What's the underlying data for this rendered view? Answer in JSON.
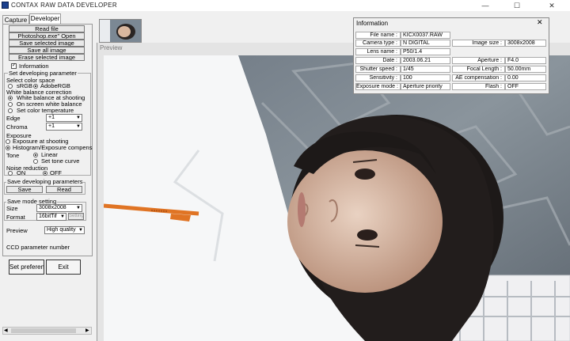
{
  "window": {
    "title": "CONTAX RAW DATA DEVELOPER",
    "controls": [
      "—",
      "☐",
      "✕"
    ]
  },
  "tabs": [
    {
      "label": "Capture"
    },
    {
      "label": "Developer"
    }
  ],
  "file_buttons": [
    {
      "label": "Read file"
    },
    {
      "label": "Photoshop.exe\" Open"
    },
    {
      "label": "Save selected image"
    },
    {
      "label": "Save all image"
    },
    {
      "label": "Erase selected image"
    }
  ],
  "information_checkbox": {
    "label": "Information",
    "checked": true
  },
  "developing": {
    "title": "Set developing parameter",
    "color_space": {
      "label": "Select color space",
      "options": [
        "sRGB",
        "AdobeRGB"
      ],
      "selected": "AdobeRGB"
    },
    "white_balance": {
      "label": "White balance correction",
      "options": [
        "White balance at shooting",
        "On screen white balance",
        "Set color temperature"
      ],
      "selected": "White balance at shooting"
    },
    "edge": {
      "label": "Edge",
      "value": "+1"
    },
    "chroma": {
      "label": "Chroma",
      "value": "+1"
    },
    "exposure": {
      "label": "Exposure",
      "options": [
        "Exposure at shooting",
        "Histogram/Exposure compens"
      ],
      "selected": "Histogram/Exposure compens"
    },
    "tone": {
      "label": "Tone",
      "options": [
        "Linear",
        "Set tone curve"
      ],
      "selected": "Linear"
    },
    "noise": {
      "label": "Noise reduction",
      "options": [
        "ON",
        "OFF"
      ],
      "selected": "OFF"
    }
  },
  "save_params": {
    "title": "Save developing parameters",
    "save": "Save",
    "read": "Read"
  },
  "save_mode": {
    "title": "Save mode setting",
    "size_label": "Size",
    "size_value": "3008x2008",
    "format_label": "Format",
    "format_value": "16bitTif",
    "setting_button": "Setting",
    "preview_label": "Preview",
    "preview_value": "High quality",
    "ccd_label": "CCD parameter number"
  },
  "bottom_buttons": {
    "preference": "Set preference",
    "exit": "Exit"
  },
  "preview": {
    "title": "Preview"
  },
  "info": {
    "title": "Information",
    "close": "✕",
    "rows": [
      [
        {
          "k": "File name",
          "v": "KICX0037.RAW"
        },
        null
      ],
      [
        {
          "k": "Camera type",
          "v": "N DIGITAL"
        },
        {
          "k": "Image size",
          "v": "3008x2008"
        }
      ],
      [
        {
          "k": "Lens name",
          "v": "P50/1.4"
        },
        null
      ],
      [
        {
          "k": "Date",
          "v": "2003.06.21"
        },
        {
          "k": "Aperture",
          "v": "F4.0"
        }
      ],
      [
        {
          "k": "Shutter speed",
          "v": "1/45"
        },
        {
          "k": "Focal Length",
          "v": "50.00mm"
        }
      ],
      [
        {
          "k": "Sensitivity",
          "v": "100"
        },
        {
          "k": "AE compensation",
          "v": "0.00"
        }
      ],
      [
        {
          "k": "Exposure mode",
          "v": "Aperture priority"
        },
        {
          "k": "Flash",
          "v": "OFF"
        }
      ]
    ]
  },
  "flat": {
    "file_name_k": "File name :",
    "file_name_v": "KICX0037.RAW",
    "camera_k": "Camera type :",
    "camera_v": "N DIGITAL",
    "lens_k": "Lens name :",
    "lens_v": "P50/1.4",
    "date_k": "Date :",
    "date_v": "2003.06.21",
    "shutter_k": "Shutter speed :",
    "shutter_v": "1/45",
    "sens_k": "Sensitivity :",
    "sens_v": "100",
    "expmode_k": "Exposure mode :",
    "expmode_v": "Aperture priority",
    "imgsize_k": "Image size :",
    "imgsize_v": "3008x2008",
    "aperture_k": "Aperture :",
    "aperture_v": "F4.0",
    "focal_k": "Focal Length :",
    "focal_v": "50.00mm",
    "aecomp_k": "AE compensation :",
    "aecomp_v": "0.00",
    "flash_k": "Flash :",
    "flash_v": "OFF"
  }
}
